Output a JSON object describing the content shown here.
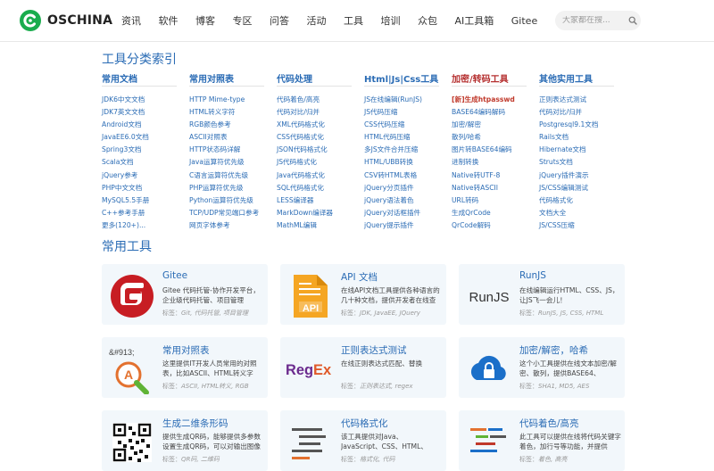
{
  "header": {
    "logo_text": "OSCHINA",
    "nav": [
      "资讯",
      "软件",
      "博客",
      "专区",
      "问答",
      "活动",
      "工具",
      "培训",
      "众包",
      "AI工具箱",
      "Gitee"
    ],
    "search_placeholder": "大家都在搜..."
  },
  "index": {
    "title": "工具分类索引",
    "columns": [
      {
        "heading": "常用文档",
        "items": [
          "JDK6中文文档",
          "JDK7英文文档",
          "Android文档",
          "JavaEE6.0文档",
          "Spring3文档",
          "Scala文档",
          "jQuery参考",
          "PHP中文文档",
          "MySQL5.5手册",
          "C++参考手册",
          "更多(120+)..."
        ]
      },
      {
        "heading": "常用对照表",
        "items": [
          "HTTP Mime-type",
          "HTML转义字符",
          "RGB颜色参考",
          "ASCII对照表",
          "HTTP状态码详解",
          "Java运算符优先级",
          "C语言运算符优先级",
          "PHP运算符优先级",
          "Python运算符优先级",
          "TCP/UDP常见端口参考",
          "网页字体参考"
        ]
      },
      {
        "heading": "代码处理",
        "items": [
          "代码着色/高亮",
          "代码对比/归并",
          "XML代码格式化",
          "CSS代码格式化",
          "JSON代码格式化",
          "JS代码格式化",
          "Java代码格式化",
          "SQL代码格式化",
          "LESS编译器",
          "MarkDown编译器",
          "MathML编辑"
        ]
      },
      {
        "heading": "Html|Js|Css工具",
        "items": [
          "JS在线编辑(RunJS)",
          "JS代码压缩",
          "CSS代码压缩",
          "HTML代码压缩",
          "多JS文件合并压缩",
          "HTML/UBB转换",
          "CSV转HTML表格",
          "jQuery分页插件",
          "jQuery语法着色",
          "jQuery对话框插件",
          "jQuery提示插件"
        ]
      },
      {
        "heading": "加密/转码工具",
        "hot": "[新]生成htpasswd",
        "items": [
          "BASE64编码解码",
          "加密/解密",
          "散列/哈希",
          "图片转BASE64编码",
          "进制转换",
          "Native转UTF-8",
          "Native转ASCII",
          "URL转码",
          "生成QrCode",
          "QrCode解码"
        ]
      },
      {
        "heading": "其他实用工具",
        "items": [
          "正则表达式测试",
          "代码对比/归并",
          "Postgresql9.1文档",
          "Rails文档",
          "Hibernate文档",
          "Struts文档",
          "jQuery插件演示",
          "JS/CSS编辑测试",
          "代码格式化",
          "文档大全",
          "JS/CSS压缩"
        ]
      }
    ]
  },
  "tools": {
    "title": "常用工具",
    "tags_label": "标签：",
    "cards": [
      {
        "title": "Gitee",
        "desc": "Gitee 代码托管-协作开发平台，企业级代码托管、项目管理",
        "tags": "Git, 代码托管, 项目管理",
        "icon": "gitee-logo-icon"
      },
      {
        "title": "API 文档",
        "desc": "在线API文档工具提供各种语言的几十种文档，提供开发者在线查",
        "tags": "JDK, JavaEE, JQuery",
        "icon": "api-doc-icon",
        "icon_text": "API"
      },
      {
        "title": "RunJS",
        "desc": "在线编辑运行HTML、CSS、JS，让JS飞一会儿！",
        "tags": "RunJS, JS, CSS, HTML",
        "icon": "runjs-logo-icon",
        "icon_text": "RunJS"
      },
      {
        "title": "常用对照表",
        "desc": "这里提供IT开发人员常用的对照表，比如ASCII、HTML转义字",
        "tags": "ASCII, HTML转义, RGB",
        "icon": "lookup-table-icon",
        "icon_text": "&#913;",
        "icon_letter": "A"
      },
      {
        "title": "正则表达式测试",
        "desc": "在线正则表达式匹配、替换",
        "tags": "正则表达式, regex",
        "icon": "regex-logo-icon",
        "icon_text_a": "Reg",
        "icon_text_b": "Ex"
      },
      {
        "title": "加密/解密，哈希",
        "desc": "这个小工具提供在线文本加密/解密、散列，提供BASE64、",
        "tags": "SHA1, MD5, AES",
        "icon": "encrypt-lock-icon"
      },
      {
        "title": "生成二维条形码",
        "desc": "提供生成QR码，能够提供多参数设置生成QR码，可以对输出图像",
        "tags": "QR码, 二维码",
        "icon": "qrcode-icon"
      },
      {
        "title": "代码格式化",
        "desc": "该工具提供对Java、JavaScript、CSS、HTML、JSON、SQL的代",
        "tags": "格式化, 代码",
        "icon": "code-format-icon"
      },
      {
        "title": "代码着色/高亮",
        "desc": "此工具可以提供在线将代码关键字着色，加行号等功能，并提供",
        "tags": "着色, 高亮",
        "icon": "code-highlight-icon"
      }
    ]
  },
  "colors": {
    "brand_green": "#1aac4d",
    "link_blue": "#2b6cb5",
    "hot_red": "#c0392b",
    "card_bg": "#f2f7fb"
  }
}
